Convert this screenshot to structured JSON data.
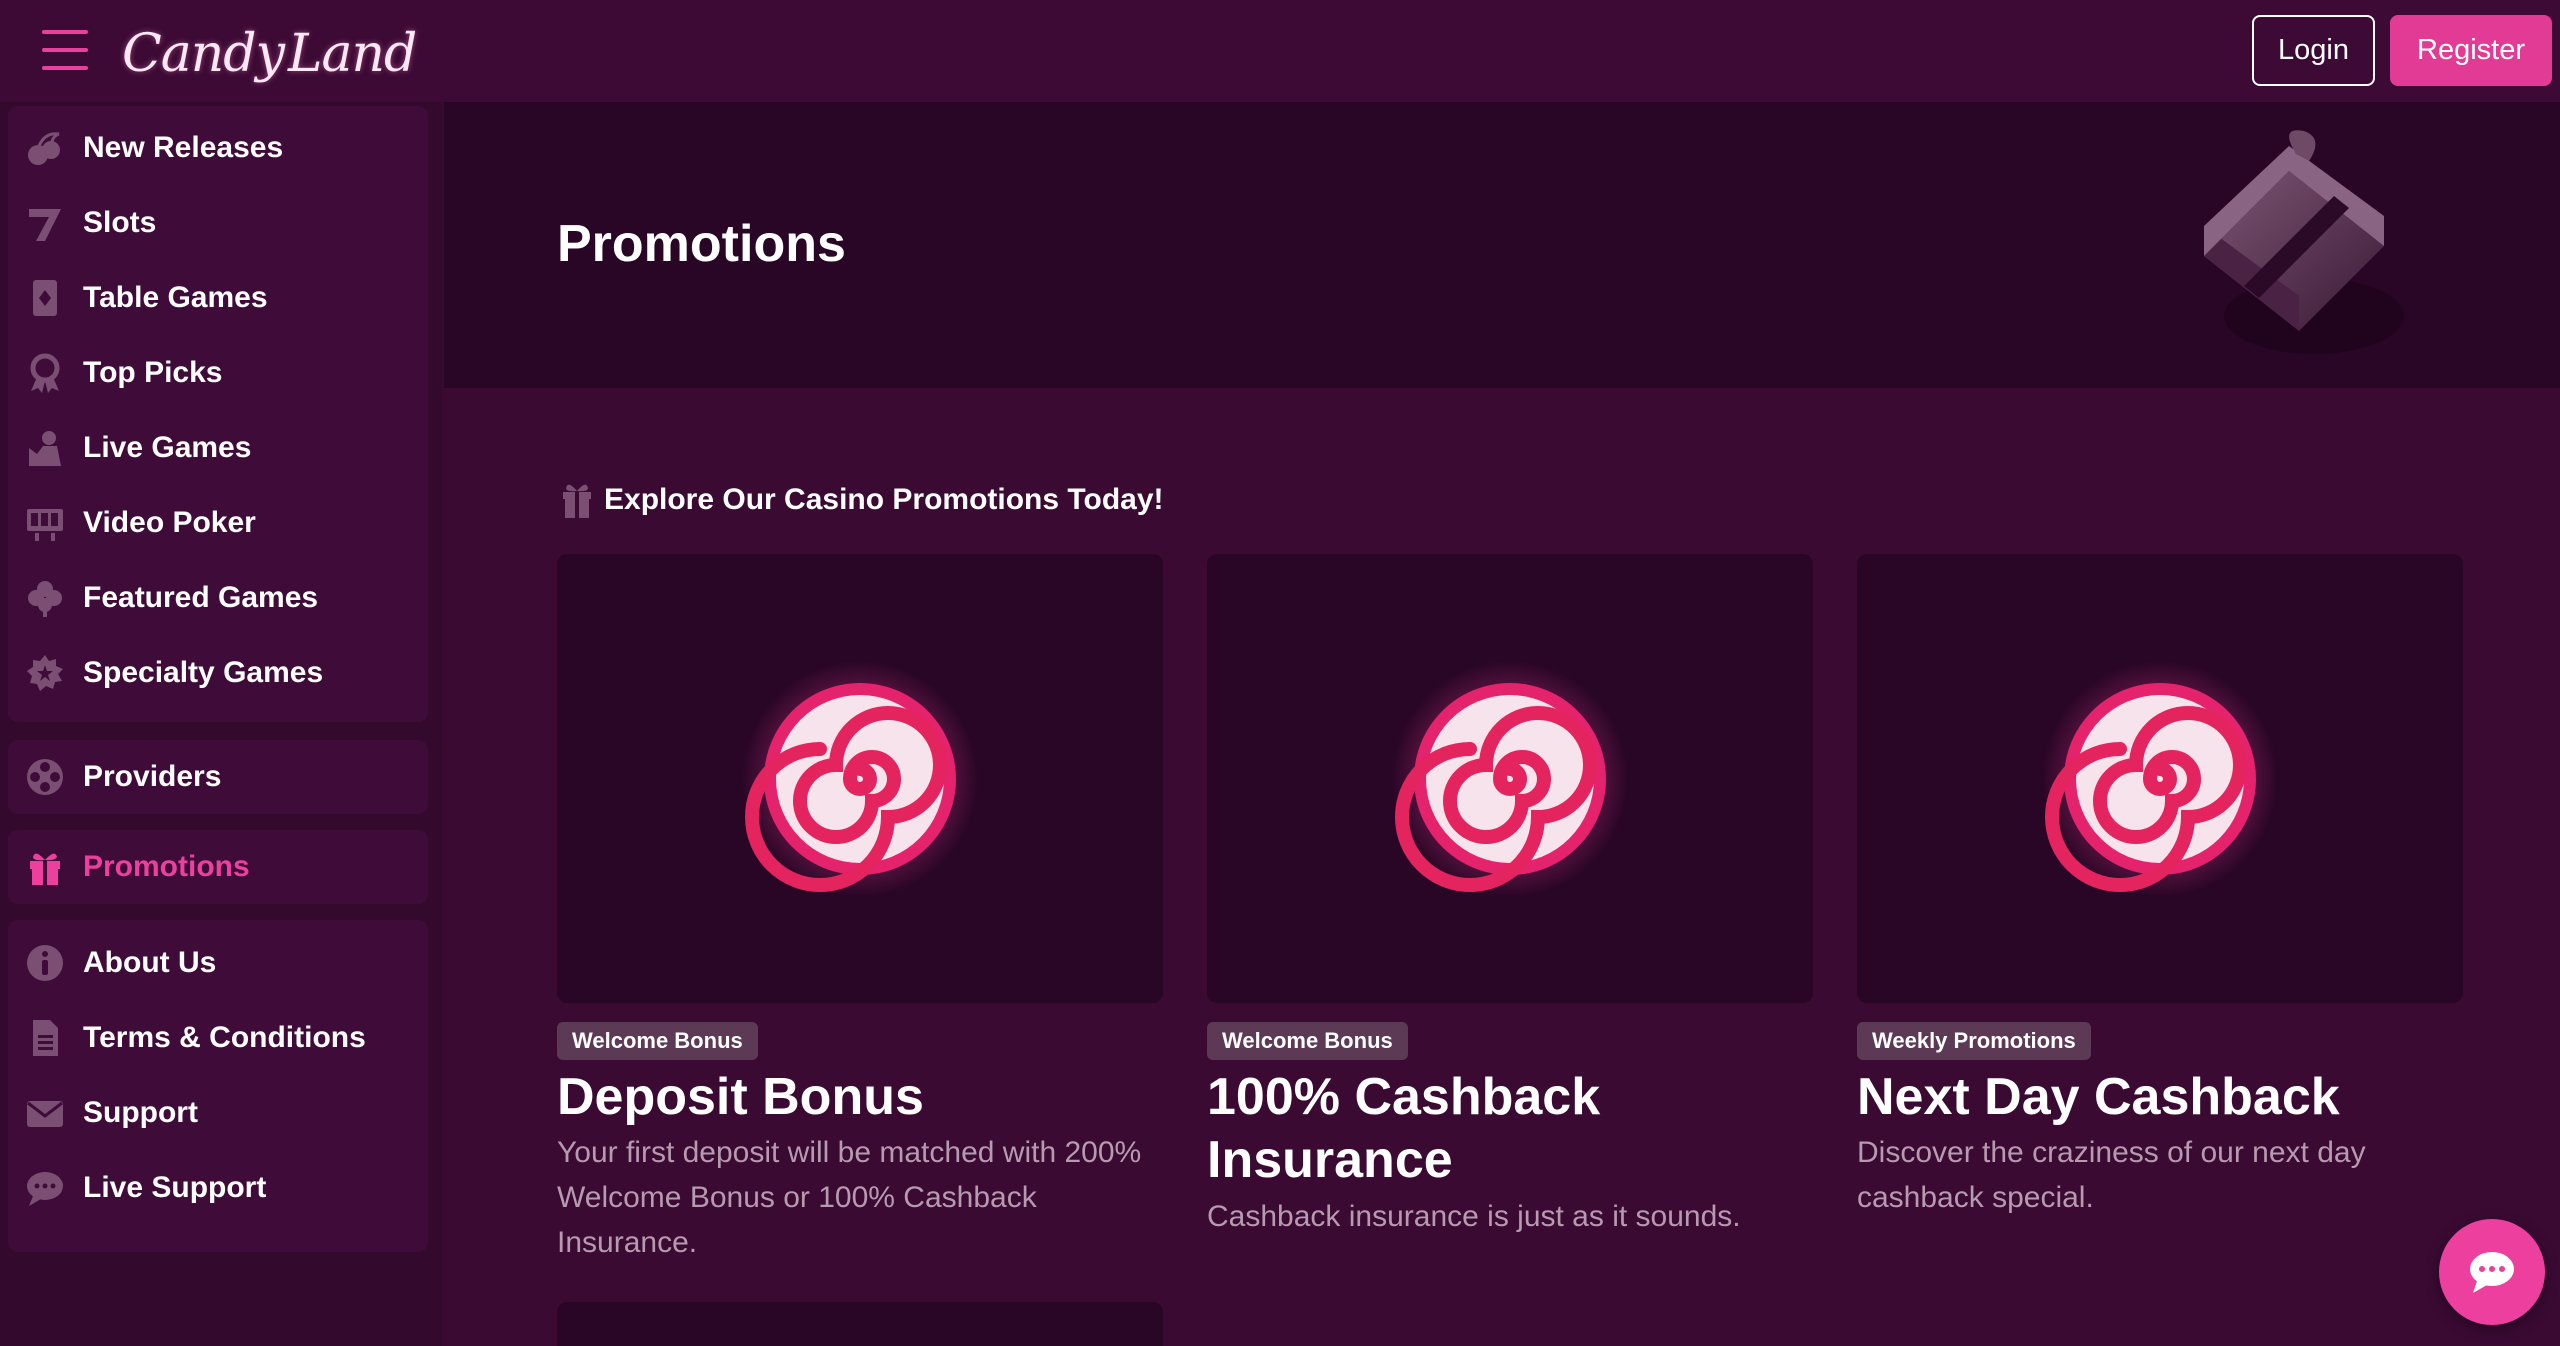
{
  "header": {
    "logo_text_left": "Candy",
    "logo_text_right": "Land",
    "login_label": "Login",
    "register_label": "Register"
  },
  "sidebar": {
    "groups": [
      {
        "items": [
          {
            "label": "New Releases",
            "icon": "cherries-icon"
          },
          {
            "label": "Slots",
            "icon": "seven-icon"
          },
          {
            "label": "Table Games",
            "icon": "playing-card-icon"
          },
          {
            "label": "Top Picks",
            "icon": "award-ribbon-icon"
          },
          {
            "label": "Live Games",
            "icon": "dealer-icon"
          },
          {
            "label": "Video Poker",
            "icon": "poker-machine-icon"
          },
          {
            "label": "Featured Games",
            "icon": "clover-icon"
          },
          {
            "label": "Specialty Games",
            "icon": "gear-star-icon"
          }
        ]
      },
      {
        "items": [
          {
            "label": "Providers",
            "icon": "film-reel-icon"
          }
        ]
      },
      {
        "items": [
          {
            "label": "Promotions",
            "icon": "gift-icon",
            "active": true
          }
        ]
      },
      {
        "items": [
          {
            "label": "About Us",
            "icon": "info-icon"
          },
          {
            "label": "Terms & Conditions",
            "icon": "document-icon"
          },
          {
            "label": "Support",
            "icon": "envelope-icon"
          },
          {
            "label": "Live Support",
            "icon": "chat-bubble-icon"
          }
        ]
      }
    ]
  },
  "hero": {
    "title": "Promotions"
  },
  "promotions": {
    "heading": "Explore Our Casino Promotions Today!",
    "cards": [
      {
        "badge": "Welcome Bonus",
        "title": "Deposit Bonus",
        "description": "Your first deposit will be matched with 200% Welcome Bonus or 100% Cashback Insurance."
      },
      {
        "badge": "Welcome Bonus",
        "title": "100% Cashback Insurance",
        "description": "Cashback insurance is just as it sounds."
      },
      {
        "badge": "Weekly Promotions",
        "title": "Next Day Cashback",
        "description": "Discover the craziness of our next day cashback special."
      }
    ]
  },
  "colors": {
    "accent": "#e23b95",
    "background": "#3a0a33",
    "sidebar_panel": "#3f0c39",
    "hero_background": "#2a0626",
    "muted_text": "#b79ab0",
    "badge_background": "#5c3a56"
  }
}
